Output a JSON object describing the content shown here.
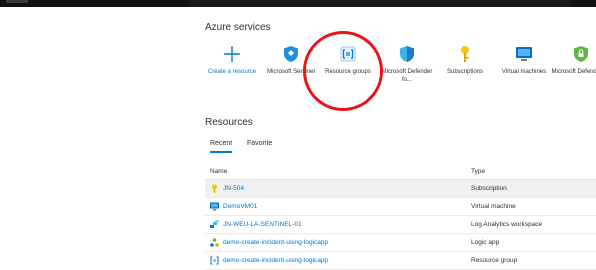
{
  "services": {
    "title": "Azure services",
    "items": [
      {
        "name": "create-resource",
        "label": "Create a resource"
      },
      {
        "name": "microsoft-sentinel",
        "label": "Microsoft Sentinel"
      },
      {
        "name": "resource-groups",
        "label": "Resource groups"
      },
      {
        "name": "microsoft-defender-for",
        "label": "Microsoft Defender fo..."
      },
      {
        "name": "subscriptions",
        "label": "Subscriptions"
      },
      {
        "name": "virtual-machines",
        "label": "Virtual machines"
      },
      {
        "name": "microsoft-defender",
        "label": "Microsoft Defender f..."
      }
    ]
  },
  "resources": {
    "title": "Resources",
    "tabs": [
      {
        "label": "Recent"
      },
      {
        "label": "Favorite"
      }
    ],
    "columns": {
      "name": "Name",
      "type": "Type"
    },
    "rows": [
      {
        "name": "JN-504",
        "type": "Subscription",
        "icon": "key-icon"
      },
      {
        "name": "DemoVM01",
        "type": "Virtual machine",
        "icon": "monitor-icon"
      },
      {
        "name": "JN-WEU-LA-SENTINEL-01",
        "type": "Log Analytics workspace",
        "icon": "log-analytics-icon"
      },
      {
        "name": "demo-create-incident-using-logicapp",
        "type": "Logic app",
        "icon": "logic-app-icon"
      },
      {
        "name": "demo-create-incident-using-logicapp",
        "type": "Resource group",
        "icon": "resource-group-icon"
      }
    ]
  },
  "colors": {
    "accent": "#0078d4",
    "annotation": "#e8141a"
  }
}
